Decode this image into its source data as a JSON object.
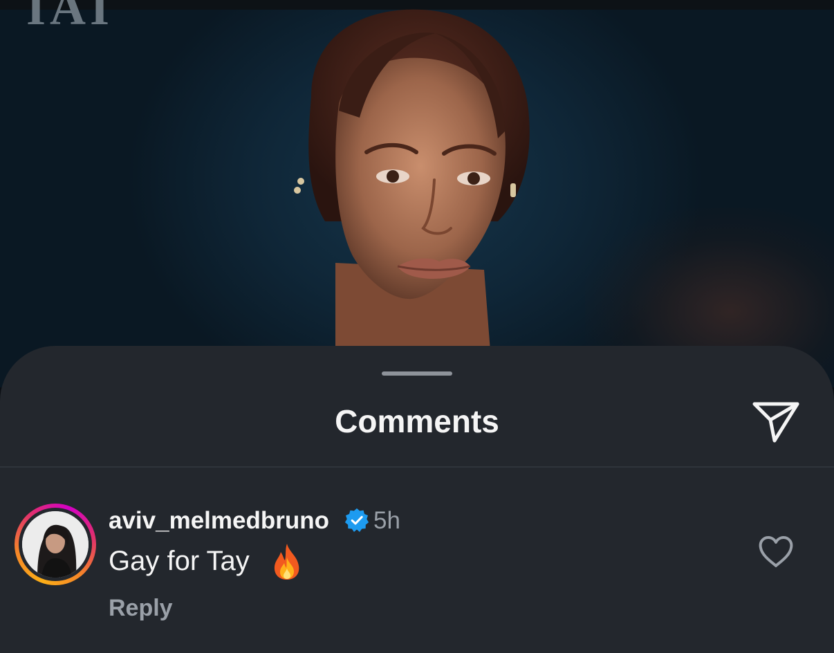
{
  "sheet": {
    "title": "Comments"
  },
  "comments": [
    {
      "username": "aviv_melmedbruno",
      "verified": true,
      "timestamp": "5h",
      "text": "Gay for Tay",
      "emoji": "fire-emoji",
      "reply_label": "Reply"
    }
  ],
  "icons": {
    "share": "paper-plane-icon",
    "like": "heart-outline-icon",
    "verified": "verified-badge-icon"
  },
  "colors": {
    "sheet_background": "#23272d",
    "verified_blue": "#1d9bf0",
    "secondary_text": "#9aa0a8",
    "primary_text": "#f5f5f5"
  }
}
